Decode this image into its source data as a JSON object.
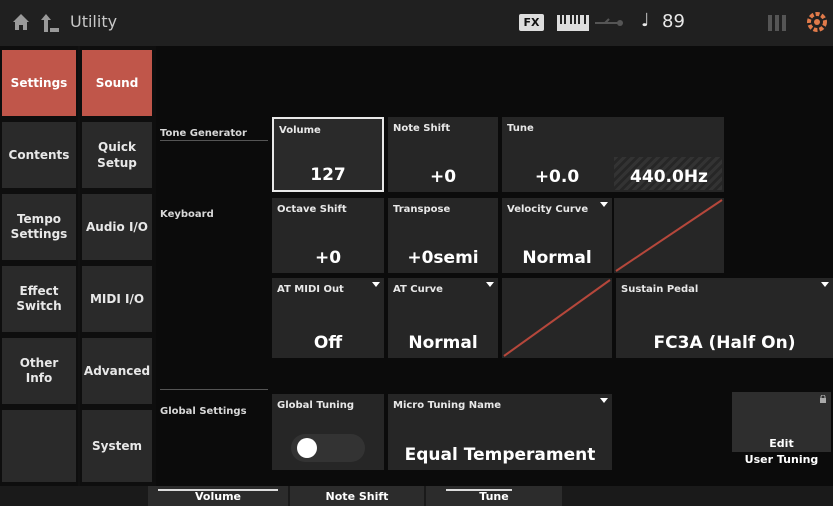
{
  "header": {
    "title": "Utility",
    "fx_label": "FX",
    "tempo_note": "♩",
    "tempo": "89"
  },
  "nav1": {
    "items": [
      {
        "label": "Settings",
        "active": true
      },
      {
        "label": "Contents",
        "active": false
      },
      {
        "label": "Tempo\nSettings",
        "active": false
      },
      {
        "label": "Effect\nSwitch",
        "active": false
      },
      {
        "label": "Other\nInfo",
        "active": false
      }
    ]
  },
  "nav2": {
    "items": [
      {
        "label": "Sound",
        "active": true
      },
      {
        "label": "Quick\nSetup",
        "active": false
      },
      {
        "label": "Audio I/O",
        "active": false
      },
      {
        "label": "MIDI I/O",
        "active": false
      },
      {
        "label": "Advanced",
        "active": false
      },
      {
        "label": "System",
        "active": false
      }
    ]
  },
  "tone_generator": {
    "label": "Tone Generator",
    "volume": {
      "label": "Volume",
      "value": "127"
    },
    "note_shift": {
      "label": "Note Shift",
      "value": "+0"
    },
    "tune": {
      "label": "Tune",
      "value": "+0.0",
      "hz": "440.0Hz"
    }
  },
  "keyboard": {
    "label": "Keyboard",
    "octave_shift": {
      "label": "Octave Shift",
      "value": "+0"
    },
    "transpose": {
      "label": "Transpose",
      "value": "+0semi"
    },
    "velocity_curve": {
      "label": "Velocity Curve",
      "value": "Normal"
    },
    "at_midi_out": {
      "label": "AT MIDI Out",
      "value": "Off"
    },
    "at_curve": {
      "label": "AT Curve",
      "value": "Normal"
    },
    "sustain_pedal": {
      "label": "Sustain Pedal",
      "value": "FC3A (Half On)"
    }
  },
  "global_settings": {
    "label": "Global Settings",
    "global_tuning": {
      "label": "Global Tuning",
      "on": false
    },
    "micro_tuning": {
      "label": "Micro Tuning Name",
      "value": "Equal Temperament"
    },
    "edit_button": "Edit\nUser Tuning"
  },
  "bottom_tabs": [
    {
      "label": "Volume"
    },
    {
      "label": "Note Shift"
    },
    {
      "label": "Tune"
    }
  ],
  "colors": {
    "accent": "#c0564a",
    "curve_line": "#b5473b"
  }
}
